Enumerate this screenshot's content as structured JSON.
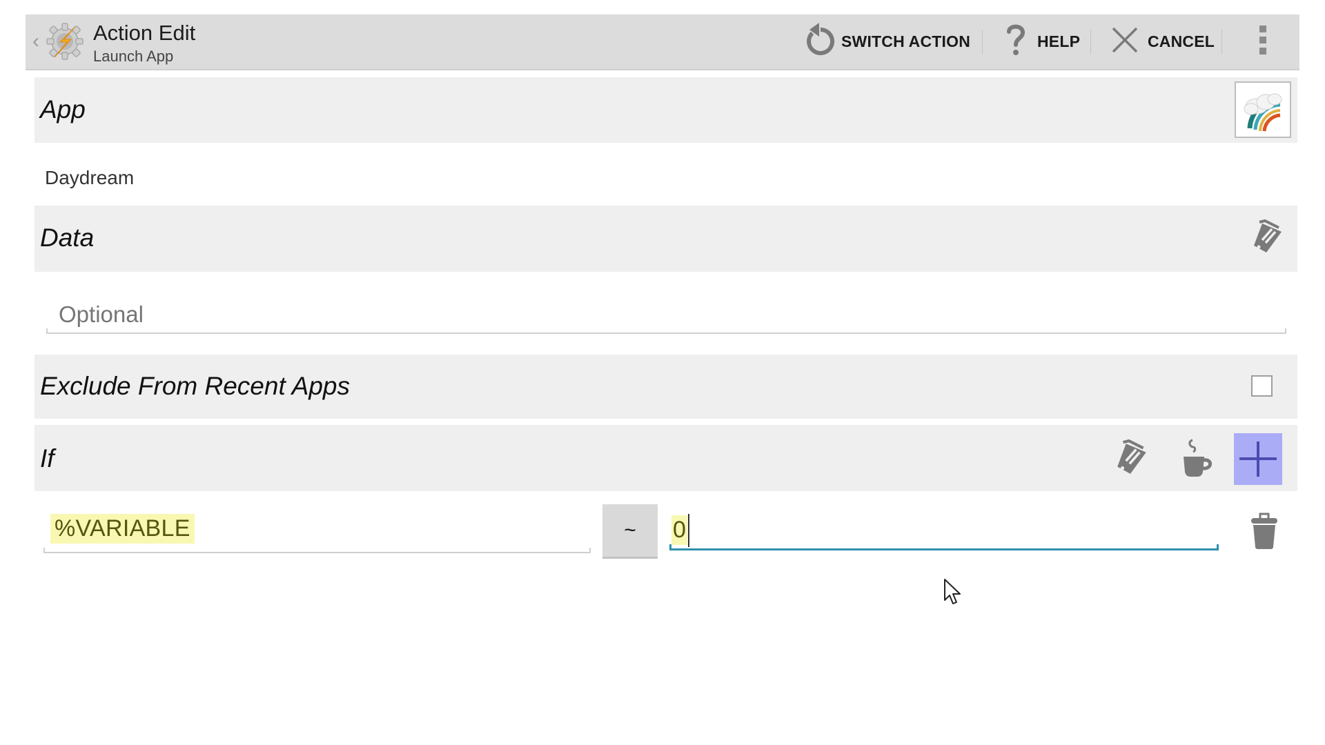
{
  "toolbar": {
    "title": "Action Edit",
    "subtitle": "Launch App",
    "icons": {
      "back": "chevron-left-icon",
      "logo": "tasker-logo-icon"
    },
    "buttons": [
      {
        "label": "SWITCH ACTION",
        "icon": "switch-action-icon"
      },
      {
        "label": "HELP",
        "icon": "help-icon"
      },
      {
        "label": "CANCEL",
        "icon": "close-icon"
      }
    ],
    "overflow_icon": "more-vertical-icon"
  },
  "sections": {
    "app": {
      "header": "App",
      "value": "Daydream",
      "icon": "daydream-app-icon"
    },
    "data": {
      "header": "Data",
      "placeholder": "Optional",
      "value": "",
      "icon": "tag-edit-icon"
    },
    "exclude": {
      "header": "Exclude From Recent Apps",
      "checked": false
    },
    "if": {
      "header": "If",
      "icons": [
        "tag-edit-icon",
        "coffee-icon",
        "plus-icon"
      ],
      "condition": {
        "variable": "%VARIABLE",
        "operator": "~",
        "value": "0"
      },
      "delete_icon": "trash-icon"
    }
  },
  "colors": {
    "toolbar_bg": "#dcdcdc",
    "band_bg": "#efefef",
    "highlight": "#f8f8b2",
    "variable_text": "#55550e",
    "active_underline": "#2f8fad",
    "plus_button": "#abacf6",
    "plus_glyph": "#4b4cb0",
    "icon_gray": "#7a7a7a"
  }
}
